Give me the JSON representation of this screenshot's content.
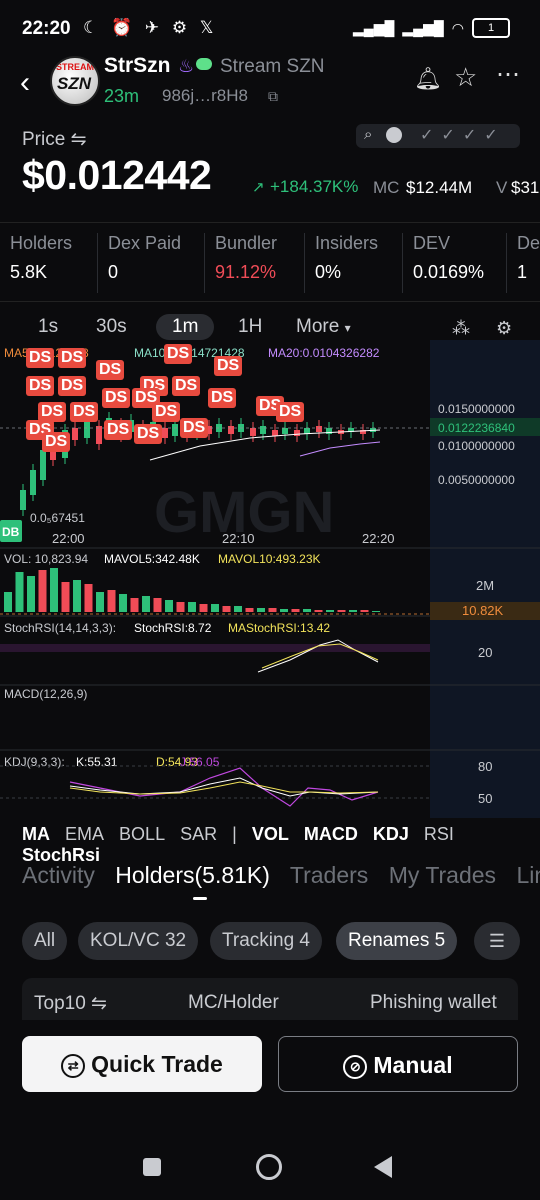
{
  "status_bar": {
    "time": "22:20",
    "battery": "1"
  },
  "header": {
    "token_symbol": "StrSzn",
    "token_name": "Stream SZN",
    "age": "23m",
    "address": "986j…r8H8",
    "logo_text_top": "STREAM",
    "logo_text_main": "SZN"
  },
  "price": {
    "label": "Price ⇋",
    "value": "$0.012442",
    "change": "+184.37K%",
    "mc_label": "MC",
    "mc_value": "$12.44M",
    "v_label": "V",
    "v_value": "$31"
  },
  "stats": [
    {
      "label": "Holders",
      "value": "5.8K"
    },
    {
      "label": "Dex Paid",
      "value": "0"
    },
    {
      "label": "Bundler",
      "value": "91.12%"
    },
    {
      "label": "Insiders",
      "value": "0%"
    },
    {
      "label": "DEV",
      "value": "0.0169%"
    },
    {
      "label": "De",
      "value": "1"
    }
  ],
  "timeframes": [
    "1s",
    "30s",
    "1m",
    "1H",
    "More"
  ],
  "active_timeframe": "1m",
  "chart_data": {
    "type": "candlestick",
    "ma_legend": {
      "ma5": "MA5:0.0122668",
      "ma10": "MA10:0.0114721428",
      "ma20": "MA20:0.0104326282"
    },
    "y_ticks": [
      "0.0150000000",
      "0.0122236840",
      "0.0100000000",
      "0.0050000000"
    ],
    "x_ticks": [
      "22:00",
      "22:10",
      "22:20"
    ],
    "low_label": "0.0₅67451",
    "badge_label": "DB",
    "watermark": "GMGN",
    "ds_badge_label": "DS",
    "volume": {
      "legend": "VOL: 10,823.94",
      "mavol5": "MAVOL5:342.48K",
      "mavol10": "MAVOL10:493.23K",
      "tick": "2M",
      "current": "10.82K"
    },
    "stochrsi": {
      "legend": "StochRSI(14,14,3,3):",
      "value": "StochRSI:8.72",
      "ma": "MAStochRSI:13.42",
      "tick": "20"
    },
    "macd": {
      "legend": "MACD(12,26,9)"
    },
    "kdj": {
      "legend": "KDJ(9,3,3):",
      "k": "K:55.31",
      "d": "D:54.93",
      "j": "J:56.05",
      "ticks": [
        "80",
        "50"
      ]
    }
  },
  "indicators": [
    "MA",
    "EMA",
    "BOLL",
    "SAR",
    "|",
    "VOL",
    "MACD",
    "KDJ",
    "RSI",
    "StochRsi"
  ],
  "tabs": [
    "Activity",
    "Holders(5.81K)",
    "Traders",
    "My Trades",
    "Lin"
  ],
  "active_tab": "Holders(5.81K)",
  "filter_chips": [
    "All",
    "KOL/VC 32",
    "Tracking 4",
    "Renames 5"
  ],
  "table_headers": [
    "Top10 ⇋",
    "MC/Holder",
    "Phishing wallet"
  ],
  "actions": {
    "quick": "Quick Trade",
    "manual": "Manual"
  }
}
